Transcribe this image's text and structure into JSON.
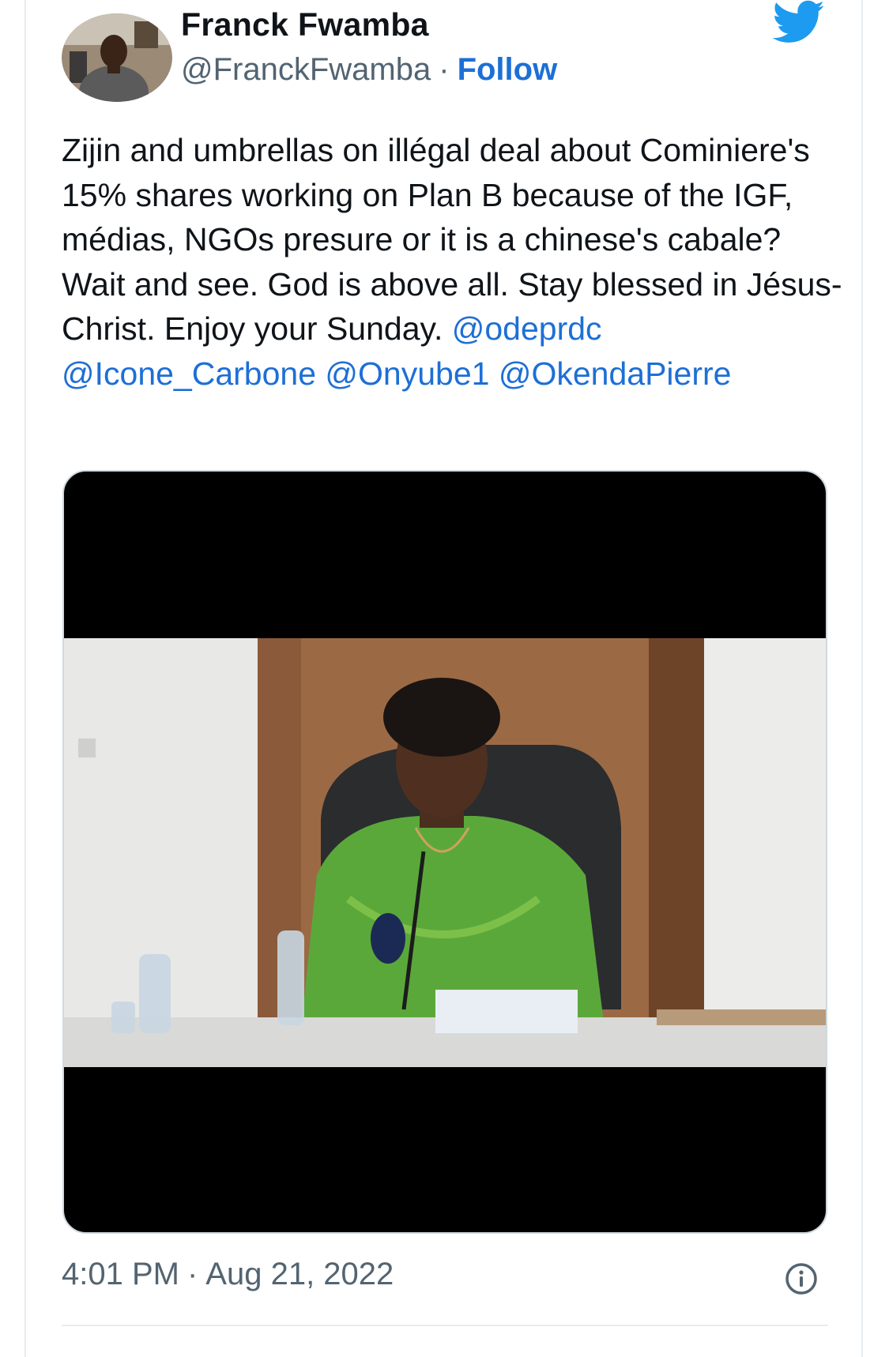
{
  "author": {
    "display_name": "Franck Fwamba",
    "handle": "@FranckFwamba",
    "separator": "·",
    "follow_label": "Follow"
  },
  "tweet": {
    "text_before_mentions": "Zijin and umbrellas on illégal deal about Cominiere's 15% shares working on Plan B because of the IGF, médias, NGOs presure or it is a chinese's cabale? Wait and see. God is above all. Stay blessed in Jésus-Christ. Enjoy your Sunday. ",
    "mentions": [
      "@odeprdc",
      "@Icone_Carbone",
      "@Onyube1",
      "@OkendaPierre"
    ]
  },
  "media": {
    "type": "video",
    "description_icon": "video-frame"
  },
  "footer": {
    "time": "4:01 PM",
    "separator": "·",
    "date": "Aug 21, 2022",
    "info_icon": "info-icon"
  },
  "colors": {
    "accent": "#1d6fd6",
    "twitter_blue": "#1d9bf0",
    "text": "#0f1419",
    "muted": "#536471",
    "border": "#cfd9de"
  }
}
